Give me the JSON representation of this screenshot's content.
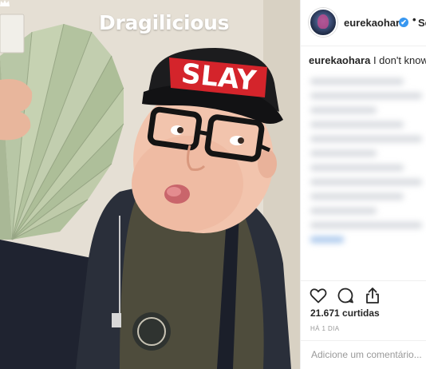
{
  "photo": {
    "brand": "Dragilicious",
    "cap_text": "SLAY"
  },
  "post": {
    "username": "eurekaohara",
    "verified_mark": "✔",
    "separator": "•",
    "follow_label": "Seg",
    "caption_user": "eurekaohara",
    "caption_text": " I don't know her",
    "likes": "21.671 curtidas",
    "time": "HÁ 1 DIA",
    "comment_placeholder": "Adicione um comentário..."
  },
  "icons": {
    "like": "heart-icon",
    "comment": "comment-icon",
    "share": "share-icon",
    "verified": "verified-badge-icon"
  },
  "colors": {
    "accent": "#3897f0",
    "text": "#262626",
    "muted": "#999999",
    "cap_red": "#d4242b"
  }
}
